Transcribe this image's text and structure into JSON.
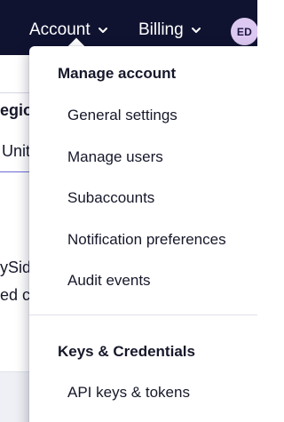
{
  "topbar": {
    "nav": [
      {
        "label": "Account",
        "icon": "chevron-down-icon"
      },
      {
        "label": "Billing",
        "icon": "chevron-down-icon"
      }
    ],
    "avatar_initials": "ED"
  },
  "background": {
    "region_label_fragment": "egion",
    "region_value_fragment": "Unit",
    "line1_fragment": "ySid",
    "line2_fragment": "ed c"
  },
  "menu": {
    "sections": [
      {
        "title": "Manage account",
        "items": [
          "General settings",
          "Manage users",
          "Subaccounts",
          "Notification preferences",
          "Audit events"
        ]
      },
      {
        "title": "Keys & Credentials",
        "items": [
          "API keys & tokens"
        ]
      }
    ]
  },
  "colors": {
    "topbar_bg": "#0f1330",
    "avatar_bg": "#dcc8f0",
    "text": "#16182a",
    "focus_underline": "#6c6bd6"
  }
}
